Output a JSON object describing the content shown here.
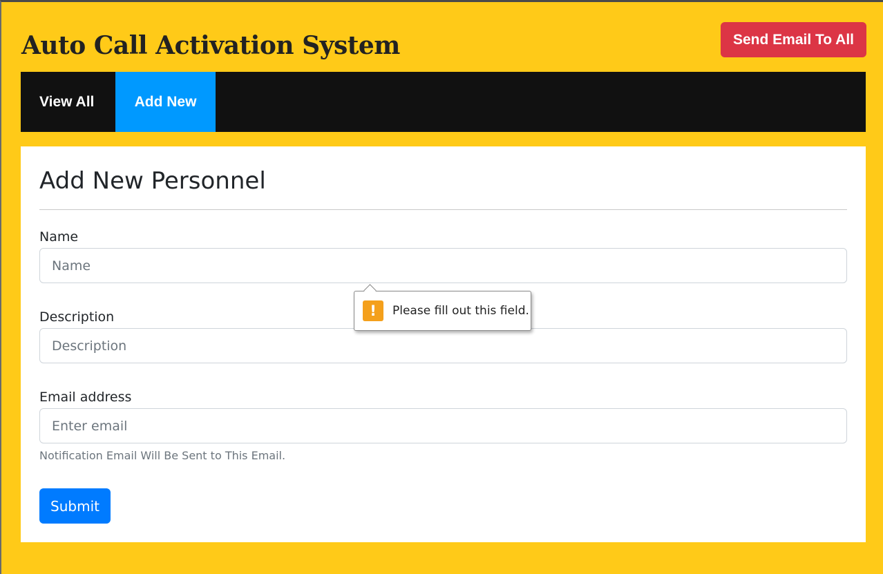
{
  "header": {
    "title": "Auto Call Activation System",
    "send_email_all_label": "Send Email To All"
  },
  "nav": {
    "items": [
      {
        "label": "View All",
        "active": false
      },
      {
        "label": "Add New",
        "active": true
      }
    ]
  },
  "form": {
    "title": "Add New Personnel",
    "name": {
      "label": "Name",
      "placeholder": "Name",
      "value": ""
    },
    "description": {
      "label": "Description",
      "placeholder": "Description",
      "value": ""
    },
    "email": {
      "label": "Email address",
      "placeholder": "Enter email",
      "value": "",
      "help": "Notification Email Will Be Sent to This Email."
    },
    "submit_label": "Submit"
  },
  "validation": {
    "icon": "warning-icon",
    "icon_glyph": "!",
    "message": "Please fill out this field."
  },
  "colors": {
    "page_background": "#ffca18",
    "navbar_background": "#111111",
    "nav_active": "#0099ff",
    "danger_button": "#dc3545",
    "primary_button": "#007bff",
    "warning": "#f4a01c"
  }
}
